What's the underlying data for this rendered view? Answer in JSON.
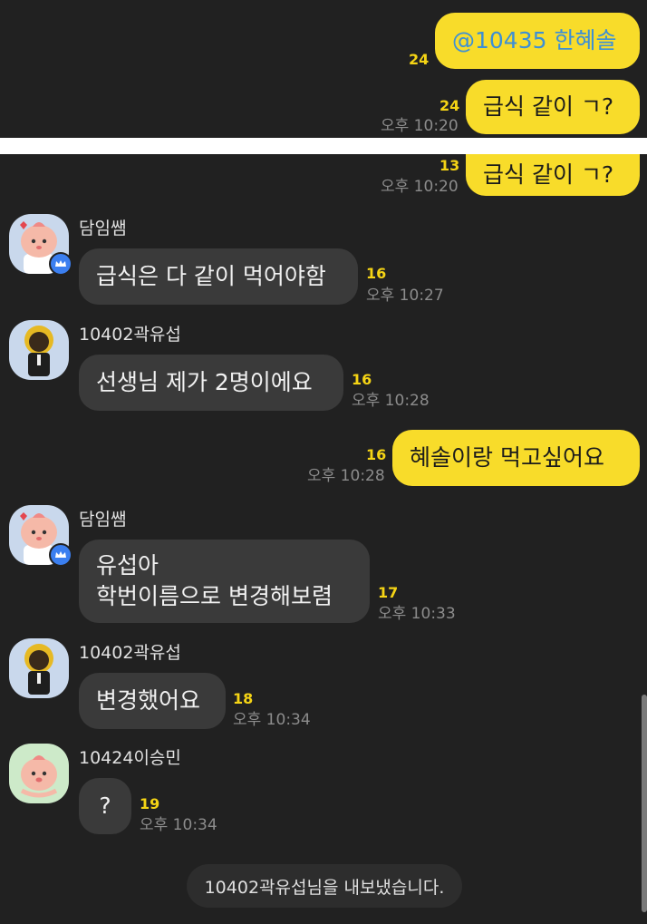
{
  "colors": {
    "background": "#212121",
    "my_bubble": "#f8dc2a",
    "their_bubble": "#3a3a3a",
    "unread_count": "#f5d415",
    "mention_text": "#3c8fd6",
    "admin_badge": "#3b7ff0"
  },
  "top_panel": {
    "messages": [
      {
        "text": "@10435 한혜솔",
        "count": "24",
        "time": ""
      },
      {
        "text": "급식 같이 ㄱ?",
        "count": "24",
        "time": "오후 10:20"
      }
    ]
  },
  "main_panel": {
    "first_message": {
      "text": "급식 같이 ㄱ?",
      "count": "13",
      "time": "오후 10:20"
    },
    "chat": [
      {
        "sender": "담임쌤",
        "avatar_icon": "apeach-teacher-icon",
        "badge": "admin-crown-icon",
        "text": "급식은 다 같이 먹어야함",
        "count": "16",
        "time": "오후 10:27"
      },
      {
        "sender": "10402곽유섭",
        "avatar_icon": "bear-suit-icon",
        "text": "선생님 제가 2명이에요",
        "count": "16",
        "time": "오후 10:28"
      },
      {
        "mine": true,
        "text": "혜솔이랑 먹고싶어요",
        "count": "16",
        "time": "오후 10:28"
      },
      {
        "sender": "담임쌤",
        "avatar_icon": "apeach-teacher-icon",
        "badge": "admin-crown-icon",
        "text": "유섭아\n학번이름으로 변경해보렴",
        "count": "17",
        "time": "오후 10:33"
      },
      {
        "sender": "10402곽유섭",
        "avatar_icon": "bear-suit-icon",
        "text": "변경했어요",
        "count": "18",
        "time": "오후 10:34"
      },
      {
        "sender": "10424이승민",
        "avatar_icon": "apeach-icon",
        "text": "?",
        "count": "19",
        "time": "오후 10:34"
      }
    ],
    "system_notice": "10402곽유섭님을 내보냈습니다."
  }
}
